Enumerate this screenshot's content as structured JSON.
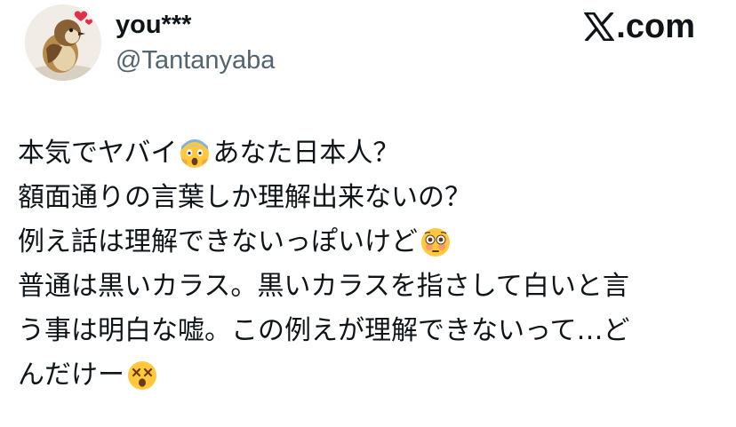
{
  "author": {
    "display_name": "you***",
    "handle": "@Tantanyaba",
    "avatar_icon": "sparrow-avatar-icon"
  },
  "brand": {
    "label": ".com",
    "logo_icon": "x-logo-icon"
  },
  "tweet": {
    "lines": [
      {
        "before": "本気でヤバイ",
        "emoji": "face-screaming-in-fear",
        "after": "あなた日本人？"
      },
      {
        "before": "額面通りの言葉しか理解出来ないの？",
        "emoji": "",
        "after": ""
      },
      {
        "before": "例え話は理解できないっぽいけど",
        "emoji": "flushed-face",
        "after": ""
      },
      {
        "before": "普通は黒いカラス。黒いカラスを指さして白いと言",
        "emoji": "",
        "after": ""
      },
      {
        "before": "う事は明白な嘘。この例えが理解できないって…ど",
        "emoji": "",
        "after": ""
      },
      {
        "before": "んだけー",
        "emoji": "dizzy-face",
        "after": ""
      }
    ]
  },
  "colors": {
    "text_primary": "#0f1419",
    "text_secondary": "#536471",
    "background": "#ffffff",
    "emoji_yellow": "#ffc83d"
  }
}
